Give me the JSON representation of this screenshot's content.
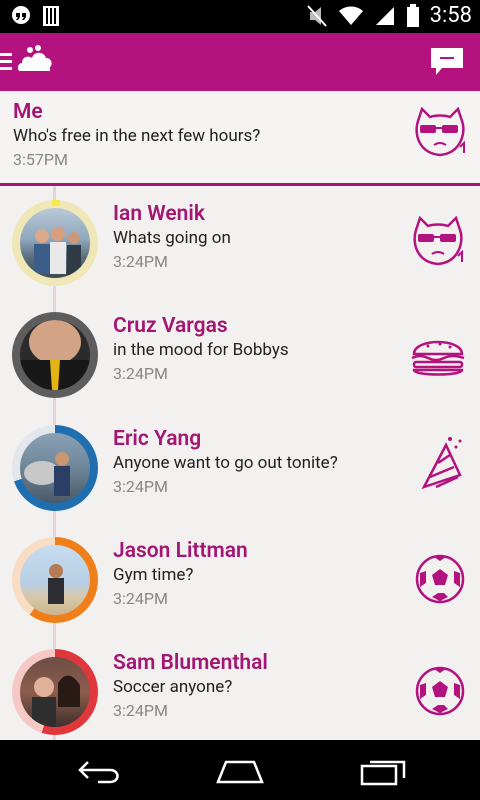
{
  "status_bar": {
    "time": "3:58"
  },
  "app_bar": {
    "menu_icon": "menu-icon",
    "logo_icon": "cloud-logo-icon",
    "compose_icon": "compose-icon",
    "brand_color": "#b3127f"
  },
  "me": {
    "name": "Me",
    "message": "Who's free in the next few hours?",
    "time": "3:57PM",
    "icon": "sunglasses-cat-icon"
  },
  "contacts": [
    {
      "name": "Ian Wenik",
      "message": "Whats going on",
      "time": "3:24PM",
      "icon": "sunglasses-cat-icon",
      "ring_color": "#efe7b6"
    },
    {
      "name": "Cruz Vargas",
      "message": "in the mood for Bobbys",
      "time": "3:24PM",
      "icon": "burger-icon",
      "ring_color": "#5d5d5d"
    },
    {
      "name": "Eric Yang",
      "message": "Anyone want to go out tonite?",
      "time": "3:24PM",
      "icon": "party-hat-icon",
      "ring_color": "#1f6fb0"
    },
    {
      "name": "Jason Littman",
      "message": "Gym time?",
      "time": "3:24PM",
      "icon": "soccer-ball-icon",
      "ring_color": "#f07f1a"
    },
    {
      "name": "Sam Blumenthal",
      "message": "Soccer anyone?",
      "time": "3:24PM",
      "icon": "soccer-ball-icon",
      "ring_color": "#e0373c"
    }
  ],
  "nav_bar": {
    "back_icon": "back-icon",
    "home_icon": "home-icon",
    "recents_icon": "recents-icon"
  }
}
